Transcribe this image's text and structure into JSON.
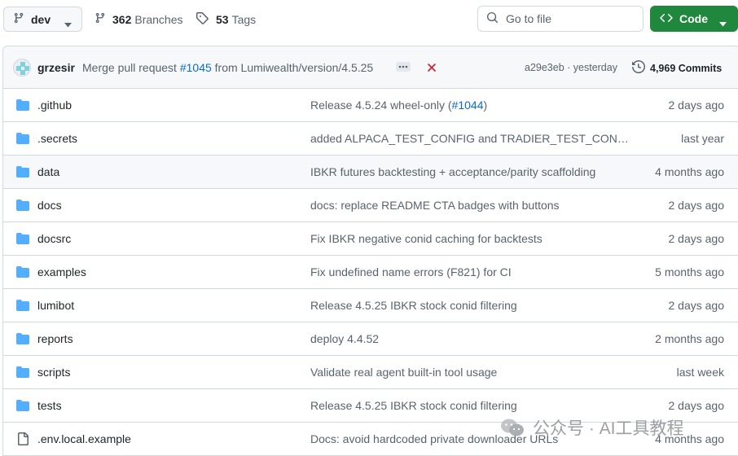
{
  "toolbar": {
    "branch": "dev",
    "branches_count": "362",
    "branches_label": "Branches",
    "tags_count": "53",
    "tags_label": "Tags",
    "goto_placeholder": "Go to file",
    "code_label": "Code"
  },
  "commit": {
    "author": "grzesir",
    "message_prefix": "Merge pull request ",
    "pr_link": "#1045",
    "message_suffix": " from Lumiwealth/version/4.5.25",
    "sha_time": "a29e3eb · yesterday",
    "commits_count": "4,969 Commits"
  },
  "files": [
    {
      "name": ".github",
      "type": "folder",
      "msg_prefix": "Release 4.5.24 wheel-only (",
      "msg_link": "#1044",
      "msg_suffix": ")",
      "date": "2 days ago"
    },
    {
      "name": ".secrets",
      "type": "folder",
      "msg_prefix": "added ALPACA_TEST_CONFIG and TRADIER_TEST_CONFI…",
      "msg_link": "",
      "msg_suffix": "",
      "date": "last year"
    },
    {
      "name": "data",
      "type": "folder",
      "msg_prefix": "IBKR futures backtesting + acceptance/parity scaffolding",
      "msg_link": "",
      "msg_suffix": "",
      "date": "4 months ago"
    },
    {
      "name": "docs",
      "type": "folder",
      "msg_prefix": "docs: replace README CTA badges with buttons",
      "msg_link": "",
      "msg_suffix": "",
      "date": "2 days ago"
    },
    {
      "name": "docsrc",
      "type": "folder",
      "msg_prefix": "Fix IBKR negative conid caching for backtests",
      "msg_link": "",
      "msg_suffix": "",
      "date": "2 days ago"
    },
    {
      "name": "examples",
      "type": "folder",
      "msg_prefix": "Fix undefined name errors (F821) for CI",
      "msg_link": "",
      "msg_suffix": "",
      "date": "5 months ago"
    },
    {
      "name": "lumibot",
      "type": "folder",
      "msg_prefix": "Release 4.5.25 IBKR stock conid filtering",
      "msg_link": "",
      "msg_suffix": "",
      "date": "2 days ago"
    },
    {
      "name": "reports",
      "type": "folder",
      "msg_prefix": "deploy 4.4.52",
      "msg_link": "",
      "msg_suffix": "",
      "date": "2 months ago"
    },
    {
      "name": "scripts",
      "type": "folder",
      "msg_prefix": "Validate real agent built-in tool usage",
      "msg_link": "",
      "msg_suffix": "",
      "date": "last week"
    },
    {
      "name": "tests",
      "type": "folder",
      "msg_prefix": "Release 4.5.25 IBKR stock conid filtering",
      "msg_link": "",
      "msg_suffix": "",
      "date": "2 days ago"
    },
    {
      "name": ".env.local.example",
      "type": "file",
      "msg_prefix": "Docs: avoid hardcoded private downloader URLs",
      "msg_link": "",
      "msg_suffix": "",
      "date": "4 months ago"
    }
  ],
  "watermark": "公众号 · AI工具教程",
  "colors": {
    "accent": "#0969da",
    "folder": "#54aeff",
    "code_button": "#1f883d",
    "danger": "#cf222e"
  },
  "icons": {
    "branch": "git-branch-icon",
    "tag": "tag-icon",
    "search": "search-icon",
    "code": "code-icon",
    "history": "history-icon",
    "folder": "folder-icon",
    "file": "file-icon"
  }
}
